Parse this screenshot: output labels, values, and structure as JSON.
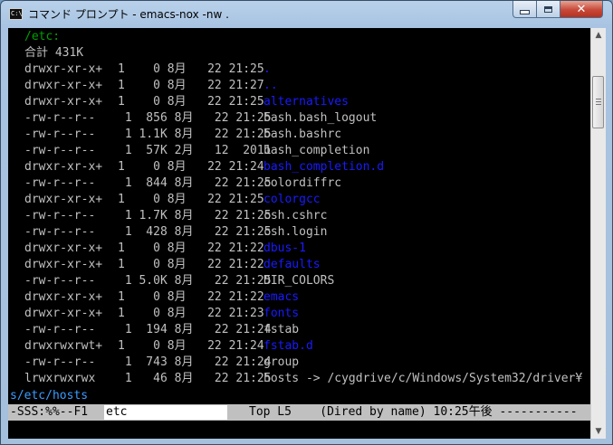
{
  "window": {
    "icon_text": "C:\\",
    "title": "コマンド プロンプト - emacs-nox  -nw ."
  },
  "dired": {
    "directory": "/etc:",
    "total": "合計 431K",
    "entries": [
      {
        "perm": "drwxr-xr-x+",
        "rest": "1    0 8月   22 21:25",
        "name": ".",
        "kind": "dir"
      },
      {
        "perm": "drwxr-xr-x+",
        "rest": "1    0 8月   22 21:27",
        "name": "..",
        "kind": "dir"
      },
      {
        "perm": "drwxr-xr-x+",
        "rest": "1    0 8月   22 21:25",
        "name": "alternatives",
        "kind": "dir"
      },
      {
        "perm": "-rw-r--r--",
        "rest": " 1  856 8月   22 21:25",
        "name": "bash.bash_logout",
        "kind": "file"
      },
      {
        "perm": "-rw-r--r--",
        "rest": " 1 1.1K 8月   22 21:25",
        "name": "bash.bashrc",
        "kind": "file"
      },
      {
        "perm": "-rw-r--r--",
        "rest": " 1  57K 2月   12  2011",
        "name": "bash_completion",
        "kind": "file"
      },
      {
        "perm": "drwxr-xr-x+",
        "rest": "1    0 8月   22 21:24",
        "name": "bash_completion.d",
        "kind": "dir"
      },
      {
        "perm": "-rw-r--r--",
        "rest": " 1  844 8月   22 21:25",
        "name": "colordiffrc",
        "kind": "file"
      },
      {
        "perm": "drwxr-xr-x+",
        "rest": "1    0 8月   22 21:25",
        "name": "colorgcc",
        "kind": "dir"
      },
      {
        "perm": "-rw-r--r--",
        "rest": " 1 1.7K 8月   22 21:25",
        "name": "csh.cshrc",
        "kind": "file"
      },
      {
        "perm": "-rw-r--r--",
        "rest": " 1  428 8月   22 21:25",
        "name": "csh.login",
        "kind": "file"
      },
      {
        "perm": "drwxr-xr-x+",
        "rest": "1    0 8月   22 21:22",
        "name": "dbus-1",
        "kind": "dir"
      },
      {
        "perm": "drwxr-xr-x+",
        "rest": "1    0 8月   22 21:22",
        "name": "defaults",
        "kind": "dir"
      },
      {
        "perm": "-rw-r--r--",
        "rest": " 1 5.0K 8月   22 21:25",
        "name": "DIR_COLORS",
        "kind": "file"
      },
      {
        "perm": "drwxr-xr-x+",
        "rest": "1    0 8月   22 21:22",
        "name": "emacs",
        "kind": "dir"
      },
      {
        "perm": "drwxr-xr-x+",
        "rest": "1    0 8月   22 21:23",
        "name": "fonts",
        "kind": "dir"
      },
      {
        "perm": "-rw-r--r--",
        "rest": " 1  194 8月   22 21:24",
        "name": "fstab",
        "kind": "file"
      },
      {
        "perm": "drwxrwxrwt+",
        "rest": "1    0 8月   22 21:24",
        "name": "fstab.d",
        "kind": "dir"
      },
      {
        "perm": "-rw-r--r--",
        "rest": " 1  743 8月   22 21:24",
        "name": "group",
        "kind": "file"
      },
      {
        "perm": "lrwxrwxrwx",
        "rest": " 1   46 8月   22 21:25",
        "name": "hosts -> /cygdrive/c/Windows/System32/driver¥",
        "kind": "link"
      }
    ],
    "minibuffer": "s/etc/hosts"
  },
  "modeline": {
    "status": "-SSS:%%--F1",
    "buffer": "etc",
    "rest": "Top L5    (Dired by name) 10:25午後 -----------"
  },
  "colors": {
    "terminal_bg": "#000000",
    "text": "#c0c0c0",
    "directory": "#1a1aff",
    "path": "#00a000",
    "minibuffer": "#3c9cff",
    "modeline_bg": "#c0c0c0"
  }
}
